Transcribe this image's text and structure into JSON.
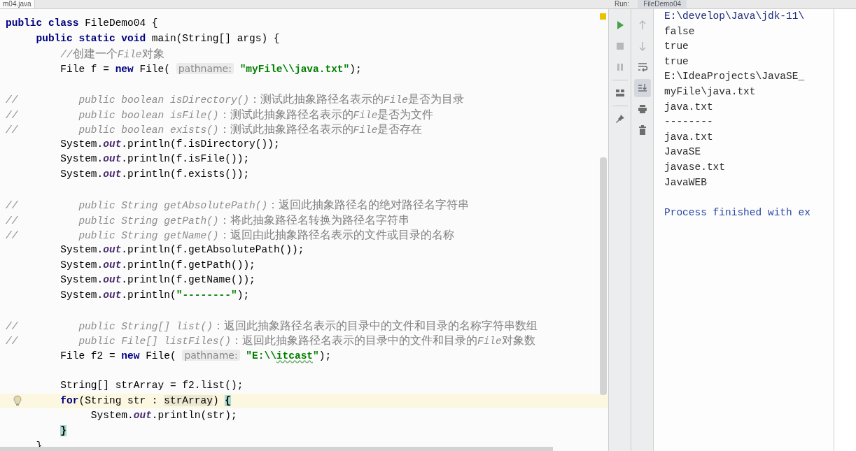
{
  "editor": {
    "tab": "m04.java",
    "lines": [
      {
        "kind": "code",
        "current": false,
        "tokens": [
          {
            "kind": "kw",
            "text": "public class "
          },
          {
            "kind": "plain",
            "text": "FileDemo04 {"
          }
        ]
      },
      {
        "kind": "code",
        "current": false,
        "tokens": [
          {
            "kind": "kw",
            "text": "     public static void "
          },
          {
            "kind": "plain",
            "text": "main(String[] args) {"
          }
        ]
      },
      {
        "kind": "code",
        "current": false,
        "tokens": [
          {
            "kind": "cmt",
            "text": "         //"
          },
          {
            "kind": "zh",
            "text": "创建一个"
          },
          {
            "kind": "cmt",
            "text": "File"
          },
          {
            "kind": "zh",
            "text": "对象"
          }
        ]
      },
      {
        "kind": "code",
        "current": false,
        "tokens": [
          {
            "kind": "plain",
            "text": "         File f = "
          },
          {
            "kind": "kw",
            "text": "new "
          },
          {
            "kind": "plain",
            "text": "File( "
          },
          {
            "kind": "hint",
            "text": "pathname:"
          },
          {
            "kind": "str",
            "text": " \"myFile\\\\java.txt\""
          },
          {
            "kind": "plain",
            "text": ");"
          }
        ]
      },
      {
        "kind": "blank",
        "current": false
      },
      {
        "kind": "code",
        "current": false,
        "tokens": [
          {
            "kind": "cmt",
            "text": "//          public boolean isDirectory()"
          },
          {
            "kind": "zh",
            "text": "：测试此抽象路径名表示的"
          },
          {
            "kind": "cmt",
            "text": "File"
          },
          {
            "kind": "zh",
            "text": "是否为目录"
          }
        ]
      },
      {
        "kind": "code",
        "current": false,
        "tokens": [
          {
            "kind": "cmt",
            "text": "//          public boolean isFile()"
          },
          {
            "kind": "zh",
            "text": "：测试此抽象路径名表示的"
          },
          {
            "kind": "cmt",
            "text": "File"
          },
          {
            "kind": "zh",
            "text": "是否为文件"
          }
        ]
      },
      {
        "kind": "code",
        "current": false,
        "tokens": [
          {
            "kind": "cmt",
            "text": "//          public boolean exists()"
          },
          {
            "kind": "zh",
            "text": "：测试此抽象路径名表示的"
          },
          {
            "kind": "cmt",
            "text": "File"
          },
          {
            "kind": "zh",
            "text": "是否存在"
          }
        ]
      },
      {
        "kind": "code",
        "current": false,
        "tokens": [
          {
            "kind": "plain",
            "text": "         System."
          },
          {
            "kind": "field",
            "text": "out"
          },
          {
            "kind": "plain",
            "text": ".println(f.isDirectory());"
          }
        ]
      },
      {
        "kind": "code",
        "current": false,
        "tokens": [
          {
            "kind": "plain",
            "text": "         System."
          },
          {
            "kind": "field",
            "text": "out"
          },
          {
            "kind": "plain",
            "text": ".println(f.isFile());"
          }
        ]
      },
      {
        "kind": "code",
        "current": false,
        "tokens": [
          {
            "kind": "plain",
            "text": "         System."
          },
          {
            "kind": "field",
            "text": "out"
          },
          {
            "kind": "plain",
            "text": ".println(f.exists());"
          }
        ]
      },
      {
        "kind": "blank",
        "current": false
      },
      {
        "kind": "code",
        "current": false,
        "tokens": [
          {
            "kind": "cmt",
            "text": "//          public String getAbsolutePath()"
          },
          {
            "kind": "zh",
            "text": "：返回此抽象路径名的绝对路径名字符串"
          }
        ]
      },
      {
        "kind": "code",
        "current": false,
        "tokens": [
          {
            "kind": "cmt",
            "text": "//          public String getPath()"
          },
          {
            "kind": "zh",
            "text": "：将此抽象路径名转换为路径名字符串"
          }
        ]
      },
      {
        "kind": "code",
        "current": false,
        "tokens": [
          {
            "kind": "cmt",
            "text": "//          public String getName()"
          },
          {
            "kind": "zh",
            "text": "：返回由此抽象路径名表示的文件或目录的名称"
          }
        ]
      },
      {
        "kind": "code",
        "current": false,
        "tokens": [
          {
            "kind": "plain",
            "text": "         System."
          },
          {
            "kind": "field",
            "text": "out"
          },
          {
            "kind": "plain",
            "text": ".println(f.getAbsolutePath());"
          }
        ]
      },
      {
        "kind": "code",
        "current": false,
        "tokens": [
          {
            "kind": "plain",
            "text": "         System."
          },
          {
            "kind": "field",
            "text": "out"
          },
          {
            "kind": "plain",
            "text": ".println(f.getPath());"
          }
        ]
      },
      {
        "kind": "code",
        "current": false,
        "tokens": [
          {
            "kind": "plain",
            "text": "         System."
          },
          {
            "kind": "field",
            "text": "out"
          },
          {
            "kind": "plain",
            "text": ".println(f.getName());"
          }
        ]
      },
      {
        "kind": "code",
        "current": false,
        "tokens": [
          {
            "kind": "plain",
            "text": "         System."
          },
          {
            "kind": "field",
            "text": "out"
          },
          {
            "kind": "plain",
            "text": ".println("
          },
          {
            "kind": "str",
            "text": "\"--------\""
          },
          {
            "kind": "plain",
            "text": ");"
          }
        ]
      },
      {
        "kind": "blank",
        "current": false
      },
      {
        "kind": "code",
        "current": false,
        "tokens": [
          {
            "kind": "cmt",
            "text": "//          public String[] list()"
          },
          {
            "kind": "zh",
            "text": "：返回此抽象路径名表示的目录中的文件和目录的名称字符串数组"
          }
        ]
      },
      {
        "kind": "code",
        "current": false,
        "tokens": [
          {
            "kind": "cmt",
            "text": "//          public File[] listFiles()"
          },
          {
            "kind": "zh",
            "text": "：返回此抽象路径名表示的目录中的文件和目录的"
          },
          {
            "kind": "cmt",
            "text": "File"
          },
          {
            "kind": "zh",
            "text": "对象数"
          }
        ]
      },
      {
        "kind": "code",
        "current": false,
        "tokens": [
          {
            "kind": "plain",
            "text": "         File f2 = "
          },
          {
            "kind": "kw",
            "text": "new "
          },
          {
            "kind": "plain",
            "text": "File( "
          },
          {
            "kind": "hint",
            "text": "pathname:"
          },
          {
            "kind": "str",
            "text": " \"E:\\\\"
          },
          {
            "kind": "typo",
            "text": "itcast"
          },
          {
            "kind": "str",
            "text": "\""
          },
          {
            "kind": "plain",
            "text": ");"
          }
        ]
      },
      {
        "kind": "blank",
        "current": false
      },
      {
        "kind": "code",
        "current": false,
        "tokens": [
          {
            "kind": "plain",
            "text": "         String[] strArray = f2.list();"
          }
        ]
      },
      {
        "kind": "code",
        "current": true,
        "tokens": [
          {
            "kind": "kw",
            "text": "         for"
          },
          {
            "kind": "plain",
            "text": "(String str : "
          },
          {
            "kind": "usage",
            "text": "strArray"
          },
          {
            "kind": "plain",
            "text": ") "
          },
          {
            "kind": "match",
            "text": "{"
          }
        ]
      },
      {
        "kind": "code",
        "current": false,
        "tokens": [
          {
            "kind": "plain",
            "text": "              System."
          },
          {
            "kind": "field",
            "text": "out"
          },
          {
            "kind": "plain",
            "text": ".println(str);"
          }
        ]
      },
      {
        "kind": "code",
        "current": false,
        "tokens": [
          {
            "kind": "match",
            "text": "         }"
          }
        ]
      },
      {
        "kind": "code",
        "current": false,
        "tokens": [
          {
            "kind": "plain",
            "text": "     }"
          }
        ]
      }
    ]
  },
  "run_panel": {
    "label": "Run:",
    "tab": "FileDemo04",
    "run_toolbar": [
      {
        "kind": "rerun",
        "disabled": false
      },
      {
        "kind": "stop",
        "disabled": true
      },
      {
        "kind": "pause",
        "disabled": true
      },
      {
        "kind": "layout",
        "disabled": false
      },
      {
        "kind": "pin",
        "disabled": false
      }
    ],
    "console_toolbar": [
      {
        "kind": "up",
        "disabled": true,
        "selected": false
      },
      {
        "kind": "down",
        "disabled": true,
        "selected": false
      },
      {
        "kind": "soft-wrap",
        "disabled": false,
        "selected": false
      },
      {
        "kind": "scroll-to-end",
        "disabled": false,
        "selected": true
      },
      {
        "kind": "print",
        "disabled": false,
        "selected": false
      },
      {
        "kind": "clear",
        "disabled": false,
        "selected": false
      }
    ],
    "output": [
      {
        "kind": "cmd",
        "text": "E:\\develop\\Java\\jdk-11\\"
      },
      {
        "kind": "out",
        "text": "false"
      },
      {
        "kind": "out",
        "text": "true"
      },
      {
        "kind": "out",
        "text": "true"
      },
      {
        "kind": "out",
        "text": "E:\\IdeaProjects\\JavaSE_"
      },
      {
        "kind": "out",
        "text": "myFile\\java.txt"
      },
      {
        "kind": "out",
        "text": "java.txt"
      },
      {
        "kind": "out",
        "text": "--------"
      },
      {
        "kind": "out",
        "text": "java.txt"
      },
      {
        "kind": "out",
        "text": "JavaSE"
      },
      {
        "kind": "out",
        "text": "javase.txt"
      },
      {
        "kind": "out",
        "text": "JavaWEB"
      },
      {
        "kind": "blank"
      },
      {
        "kind": "exit",
        "text": "Process finished with ex"
      }
    ]
  }
}
